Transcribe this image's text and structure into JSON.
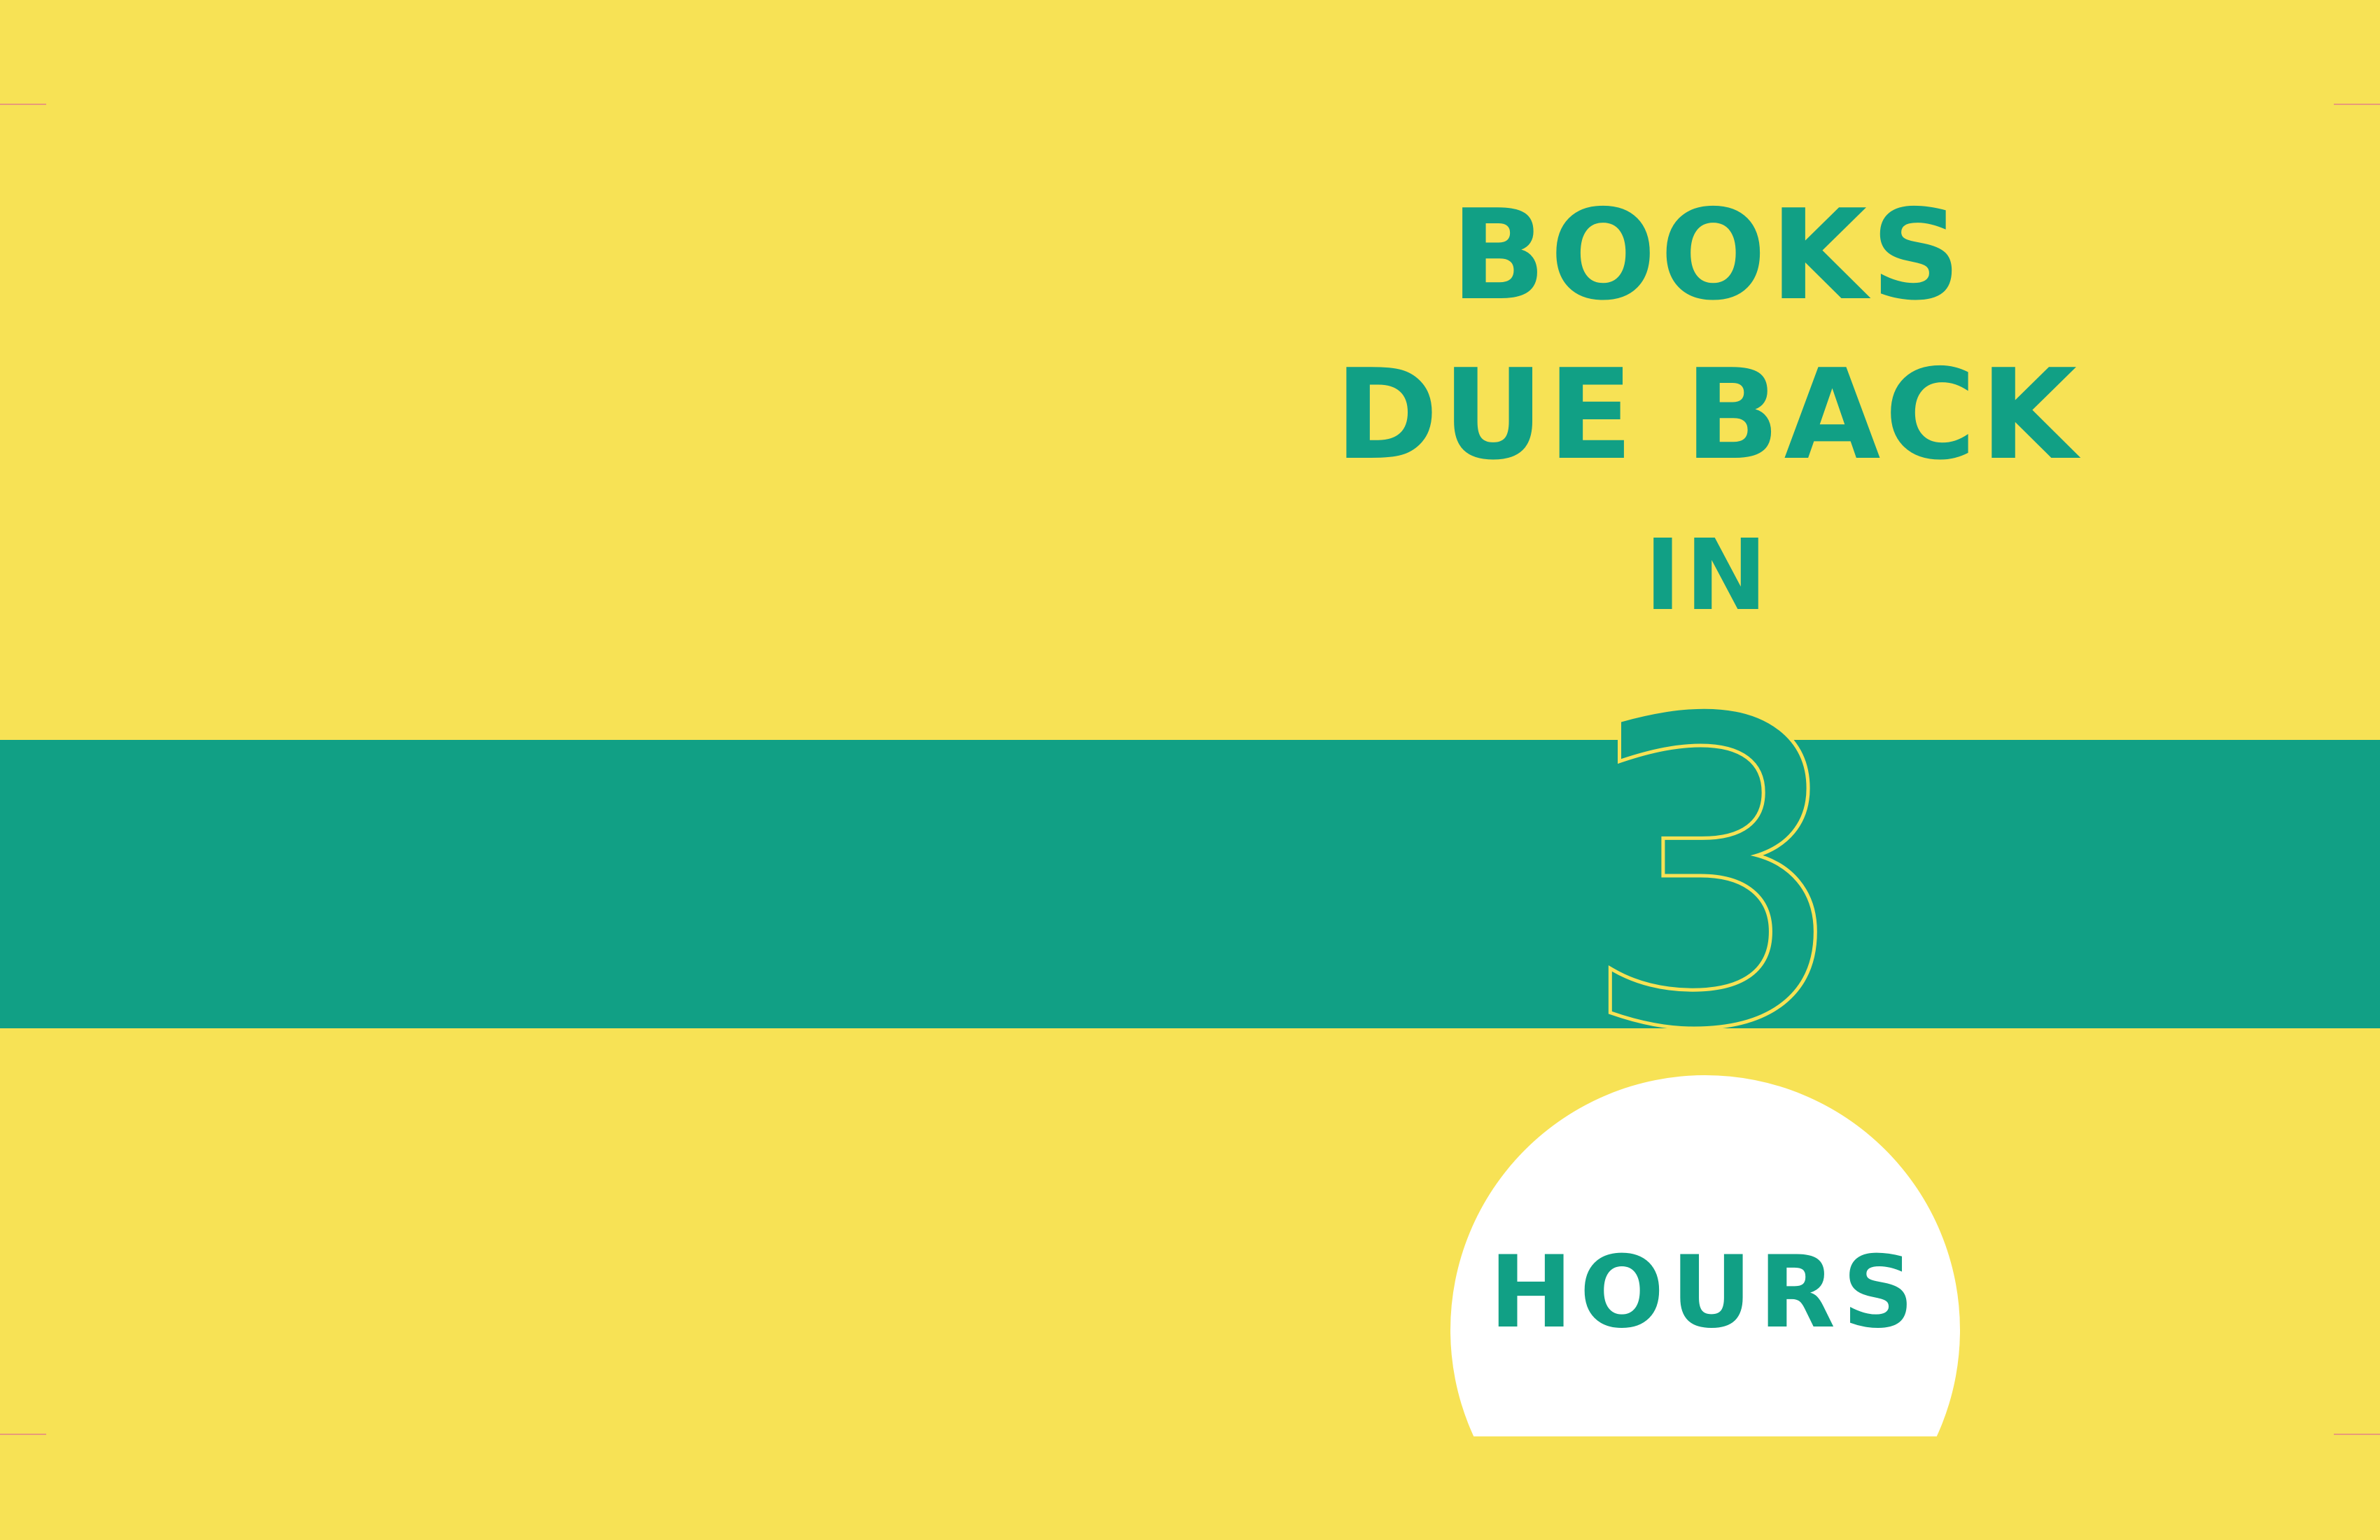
{
  "colors": {
    "background": "#f7e255",
    "accent_teal": "#11a085",
    "circle_fill": "#ffffff",
    "crop_mark": "#e89a7a"
  },
  "headline": {
    "line_1": "BOOKS",
    "line_2": "DUE BACK",
    "line_3": "IN"
  },
  "count": {
    "value": "3",
    "unit": "HOURS"
  }
}
